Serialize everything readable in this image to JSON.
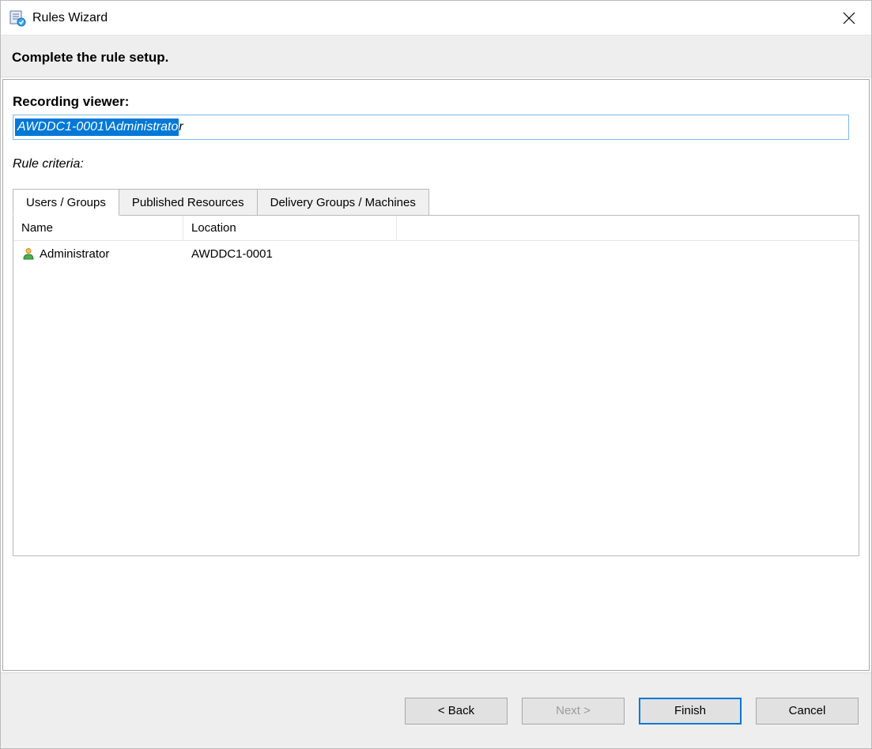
{
  "title": "Rules Wizard",
  "header": "Complete the rule setup.",
  "section_viewer_label": "Recording viewer:",
  "viewer_value_selected": "AWDDC1-0001\\Administrato",
  "viewer_value_tail": "r",
  "criteria_label": "Rule criteria:",
  "tabs": {
    "users_groups": "Users / Groups",
    "published_resources": "Published Resources",
    "delivery_groups": "Delivery Groups / Machines"
  },
  "columns": {
    "name": "Name",
    "location": "Location"
  },
  "rows": [
    {
      "name": "Administrator",
      "location": "AWDDC1-0001"
    }
  ],
  "buttons": {
    "back": "< Back",
    "next": "Next >",
    "finish": "Finish",
    "cancel": "Cancel"
  }
}
